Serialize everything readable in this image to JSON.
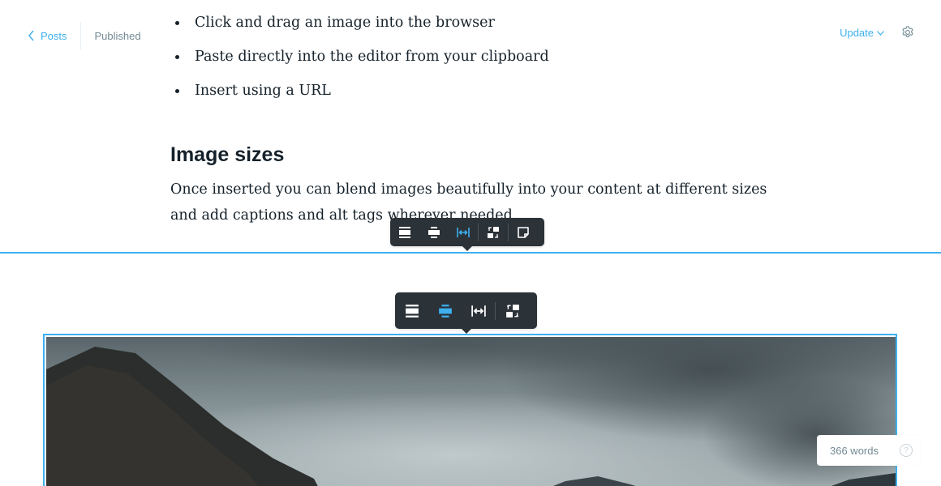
{
  "header": {
    "back_label": "Posts",
    "status": "Published",
    "update_label": "Update"
  },
  "content": {
    "bullets": [
      "Click and drag an image into the browser",
      "Paste directly into the editor from your clipboard",
      "Insert using a URL"
    ],
    "heading": "Image sizes",
    "paragraph": "Once inserted you can blend images beautifully into your content at different sizes and add captions and alt tags wherever needed."
  },
  "toolbars": {
    "text_toolbar": {
      "buttons": [
        "image-regular-icon",
        "image-wide-icon",
        "image-full-icon",
        "replace-image-icon",
        "snippet-icon"
      ],
      "active": "image-full-icon"
    },
    "image_toolbar": {
      "buttons": [
        "image-regular-icon",
        "image-wide-icon",
        "image-full-icon",
        "replace-image-icon"
      ],
      "active": "image-wide-icon"
    }
  },
  "footer": {
    "word_count": "366 words",
    "help_symbol": "?"
  },
  "colors": {
    "accent": "#3eb0ef",
    "text": "#15212a",
    "muted": "#738a94",
    "toolbar_bg": "#2b3238"
  }
}
